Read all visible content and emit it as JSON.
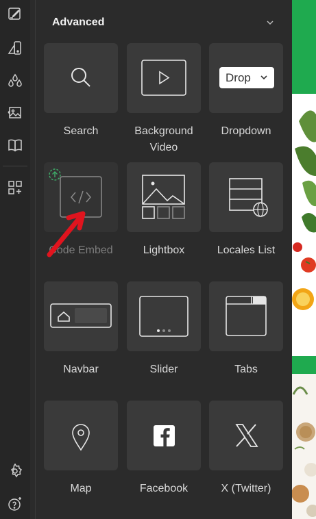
{
  "panel": {
    "title": "Advanced",
    "collapse_icon": "chevron-down-icon"
  },
  "rail": {
    "icons": [
      "style-editor-icon",
      "shape-icon",
      "drops-icon",
      "image-icon",
      "book-icon",
      "add-elements-icon",
      "settings-gear-icon",
      "help-ai-icon"
    ]
  },
  "tiles": {
    "search": {
      "label": "Search"
    },
    "background_video": {
      "label": "Background\nVideo"
    },
    "dropdown": {
      "label": "Dropdown",
      "preview_text": "Drop"
    },
    "code_embed": {
      "label": "Code Embed",
      "badge": "upgrade-icon"
    },
    "lightbox": {
      "label": "Lightbox"
    },
    "locales_list": {
      "label": "Locales List"
    },
    "navbar": {
      "label": "Navbar"
    },
    "slider": {
      "label": "Slider"
    },
    "tabs": {
      "label": "Tabs"
    },
    "map": {
      "label": "Map"
    },
    "facebook": {
      "label": "Facebook"
    },
    "x_twitter": {
      "label": "X (Twitter)"
    }
  },
  "colors": {
    "panel_bg": "#2b2b2b",
    "tile_bg": "#3a3a3a",
    "accent_green": "#1faa4f",
    "annotation_red": "#e0141e"
  }
}
